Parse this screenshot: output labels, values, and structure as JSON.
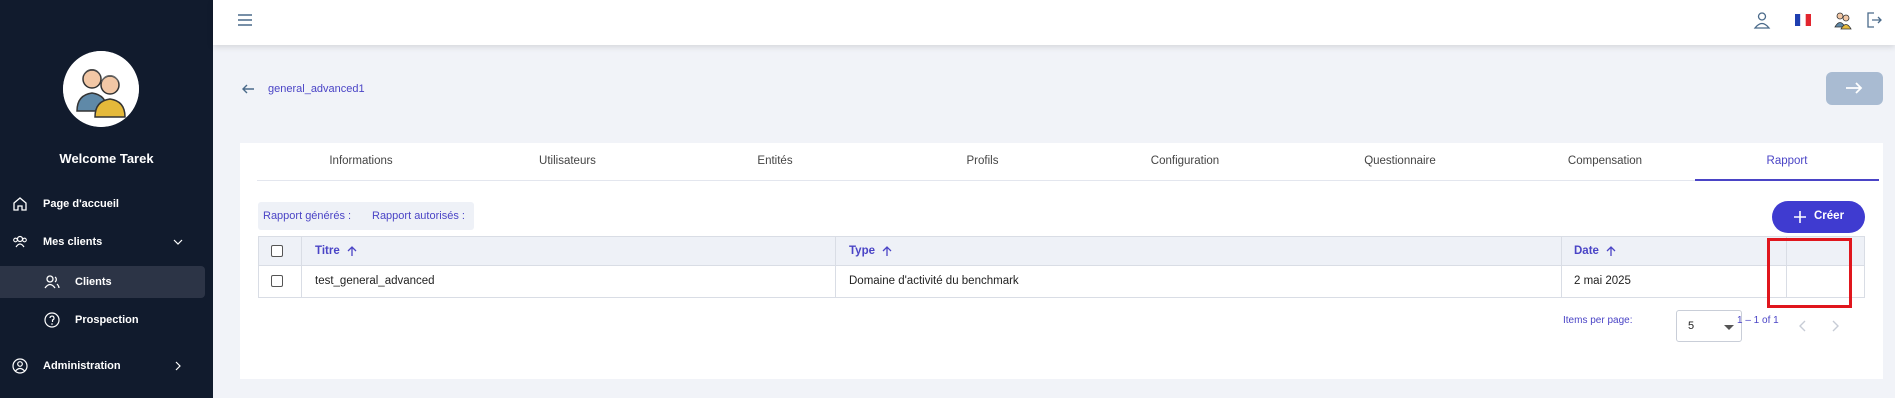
{
  "sidebar": {
    "welcome": "Welcome Tarek",
    "items": [
      {
        "label": "Page d'accueil",
        "icon": "home-icon"
      },
      {
        "label": "Mes clients",
        "icon": "users-icon"
      },
      {
        "label": "Clients",
        "icon": "user-group-icon"
      },
      {
        "label": "Prospection",
        "icon": "help-circle-icon"
      },
      {
        "label": "Administration",
        "icon": "user-circle-icon"
      }
    ]
  },
  "breadcrumb": {
    "label": "general_advanced1"
  },
  "tabs": [
    "Informations",
    "Utilisateurs",
    "Entités",
    "Profils",
    "Configuration",
    "Questionnaire",
    "Compensation",
    "Rapport"
  ],
  "active_tab": "Rapport",
  "filters": {
    "generated": "Rapport générés :",
    "authorized": "Rapport autorisés :"
  },
  "create_button": "Créer",
  "table": {
    "headers": [
      "Titre",
      "Type",
      "Date"
    ],
    "rows": [
      {
        "titre": "test_general_advanced",
        "type": "Domaine d'activité du benchmark",
        "date": "2 mai 2025"
      }
    ]
  },
  "pagination": {
    "items_per_page_label": "Items per page:",
    "items_per_page": "5",
    "range": "1 – 1 of 1"
  },
  "colors": {
    "sidebar": "#111b2d",
    "accent": "#4a44c6",
    "button": "#3f3bd0",
    "highlight": "#e0161d"
  }
}
